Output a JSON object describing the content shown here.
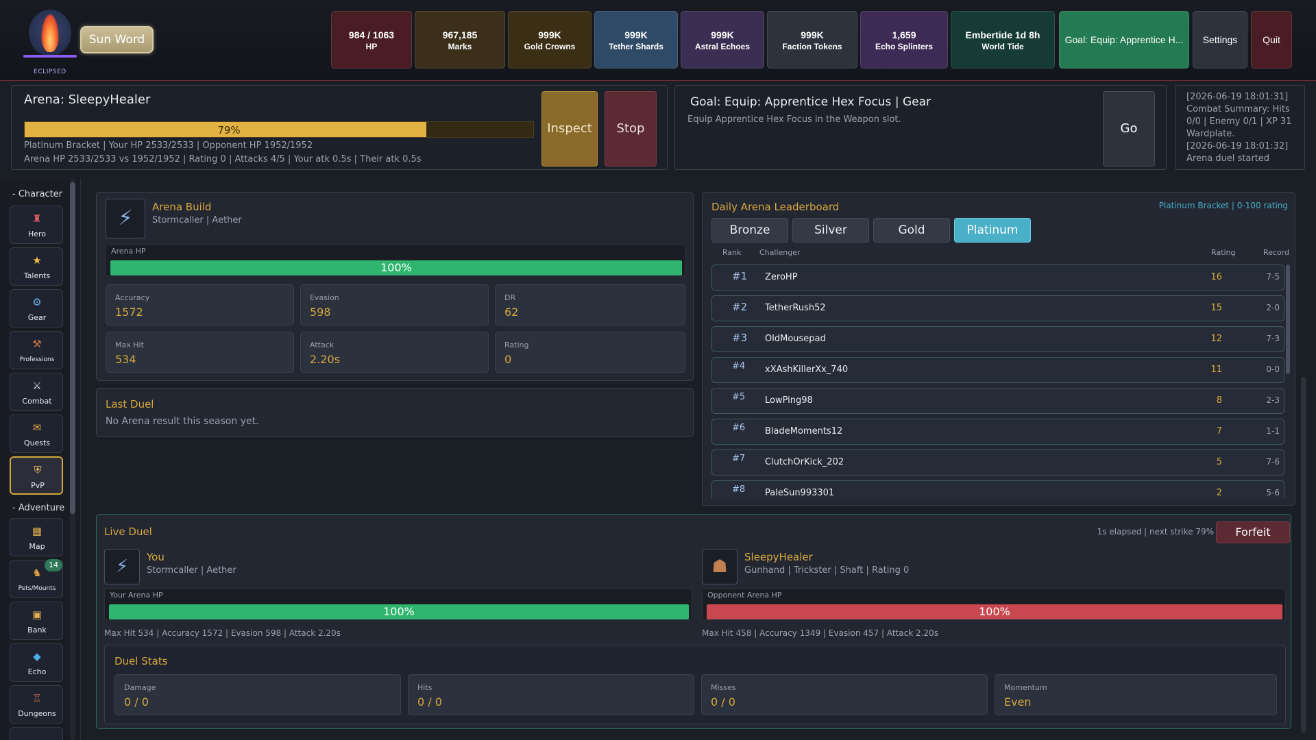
{
  "header": {
    "logo_tag": "ECLIPSED",
    "sun_word": "Sun Word",
    "stats": [
      {
        "value": "984 / 1063",
        "label": "HP"
      },
      {
        "value": "967,185",
        "label": "Marks"
      },
      {
        "value": "999K",
        "label": "Gold Crowns"
      },
      {
        "value": "999K",
        "label": "Tether Shards"
      },
      {
        "value": "999K",
        "label": "Astral Echoes"
      },
      {
        "value": "999K",
        "label": "Faction Tokens"
      },
      {
        "value": "1,659",
        "label": "Echo Splinters"
      },
      {
        "value": "Embertide 1d 8h",
        "label": "World Tide"
      }
    ],
    "goal_button": "Goal: Equip: Apprentice H...",
    "settings": "Settings",
    "quit": "Quit"
  },
  "arena_action": {
    "title": "Arena: SleepyHealer",
    "progress_pct": 79,
    "progress_label": "79%",
    "line1": "Platinum Bracket | Your HP 2533/2533 | Opponent HP 1952/1952",
    "line2": "Arena HP 2533/2533 vs 1952/1952 | Rating 0 | Attacks 4/5 | Your atk 0.5s | Their atk 0.5s",
    "inspect": "Inspect",
    "stop": "Stop"
  },
  "goal_panel": {
    "title": "Goal: Equip: Apprentice Hex Focus | Gear",
    "desc": "Equip Apprentice Hex Focus in the Weapon slot.",
    "go": "Go"
  },
  "log": {
    "lines": [
      "[2026-06-19 18:01:31]",
      "Combat Summary: Hits",
      "0/0 | Enemy 0/1 | XP 31",
      "Wardplate.",
      "[2026-06-19 18:01:32]",
      "Arena duel started"
    ]
  },
  "sidebar": {
    "character_header": "- Character",
    "adventure_header": "- Adventure",
    "character_items": [
      {
        "label": "Hero",
        "icon": "hero-icon"
      },
      {
        "label": "Talents",
        "icon": "talents-icon"
      },
      {
        "label": "Gear",
        "icon": "gear-icon"
      },
      {
        "label": "Professions",
        "icon": "professions-icon"
      },
      {
        "label": "Combat",
        "icon": "combat-icon"
      },
      {
        "label": "Quests",
        "icon": "quests-icon"
      },
      {
        "label": "PvP",
        "icon": "pvp-icon"
      }
    ],
    "adventure_items": [
      {
        "label": "Map",
        "icon": "map-icon"
      },
      {
        "label": "Pets/Mounts",
        "icon": "pets-icon",
        "badge": "14"
      },
      {
        "label": "Bank",
        "icon": "bank-icon"
      },
      {
        "label": "Echo",
        "icon": "echo-icon"
      },
      {
        "label": "Dungeons",
        "icon": "dungeons-icon"
      }
    ]
  },
  "arena_build": {
    "title": "Arena Build",
    "subtitle": "Stormcaller | Aether",
    "hp_label": "Arena HP",
    "hp_pct": 100,
    "hp_text": "100%",
    "stats": [
      {
        "label": "Accuracy",
        "value": "1572"
      },
      {
        "label": "Evasion",
        "value": "598"
      },
      {
        "label": "DR",
        "value": "62"
      },
      {
        "label": "Max Hit",
        "value": "534"
      },
      {
        "label": "Attack",
        "value": "2.20s"
      },
      {
        "label": "Rating",
        "value": "0"
      }
    ]
  },
  "last_duel": {
    "title": "Last Duel",
    "text": "No Arena result this season yet."
  },
  "leaderboard": {
    "title": "Daily Arena Leaderboard",
    "bracket_info": "Platinum Bracket | 0-100 rating",
    "tabs": [
      "Bronze",
      "Silver",
      "Gold",
      "Platinum"
    ],
    "active_tab": 3,
    "columns": {
      "rank": "Rank",
      "challenger": "Challenger",
      "rating": "Rating",
      "record": "Record"
    },
    "rows": [
      {
        "rank": "#1",
        "name": "ZeroHP",
        "rating": "16",
        "record": "7-5"
      },
      {
        "rank": "#2",
        "name": "TetherRush52",
        "rating": "15",
        "record": "2-0"
      },
      {
        "rank": "#3",
        "name": "OldMousepad",
        "rating": "12",
        "record": "7-3"
      },
      {
        "rank": "#4",
        "name": "xXAshKillerXx_740",
        "rating": "11",
        "record": "0-0"
      },
      {
        "rank": "#5",
        "name": "LowPing98",
        "rating": "8",
        "record": "2-3"
      },
      {
        "rank": "#6",
        "name": "BladeMoments12",
        "rating": "7",
        "record": "1-1"
      },
      {
        "rank": "#7",
        "name": "ClutchOrKick_202",
        "rating": "5",
        "record": "7-6"
      },
      {
        "rank": "#8",
        "name": "PaleSun993301",
        "rating": "2",
        "record": "5-6"
      }
    ]
  },
  "live_duel": {
    "title": "Live Duel",
    "status": "1s elapsed | next strike 79%",
    "forfeit": "Forfeit",
    "you": {
      "name": "You",
      "sub": "Stormcaller | Aether",
      "hp_label": "Your Arena HP",
      "hp_pct": 100,
      "hp_text": "100%",
      "stats": "Max Hit 534 | Accuracy 1572 | Evasion 598 | Attack 2.20s"
    },
    "opponent": {
      "name": "SleepyHealer",
      "sub": "Gunhand | Trickster | Shaft | Rating 0",
      "hp_label": "Opponent Arena HP",
      "hp_pct": 100,
      "hp_text": "100%",
      "stats": "Max Hit 458 | Accuracy 1349 | Evasion 457 | Attack 2.20s"
    },
    "duel_stats_title": "Duel Stats",
    "duel_stats": [
      {
        "label": "Damage",
        "value": "0 / 0"
      },
      {
        "label": "Hits",
        "value": "0 / 0"
      },
      {
        "label": "Misses",
        "value": "0 / 0"
      },
      {
        "label": "Momentum",
        "value": "Even"
      }
    ]
  },
  "colors": {
    "gold": "#d9a83c",
    "hp_green": "#2fb56e",
    "opponent_red": "#c9484f",
    "platinum": "#4ab0c8"
  }
}
